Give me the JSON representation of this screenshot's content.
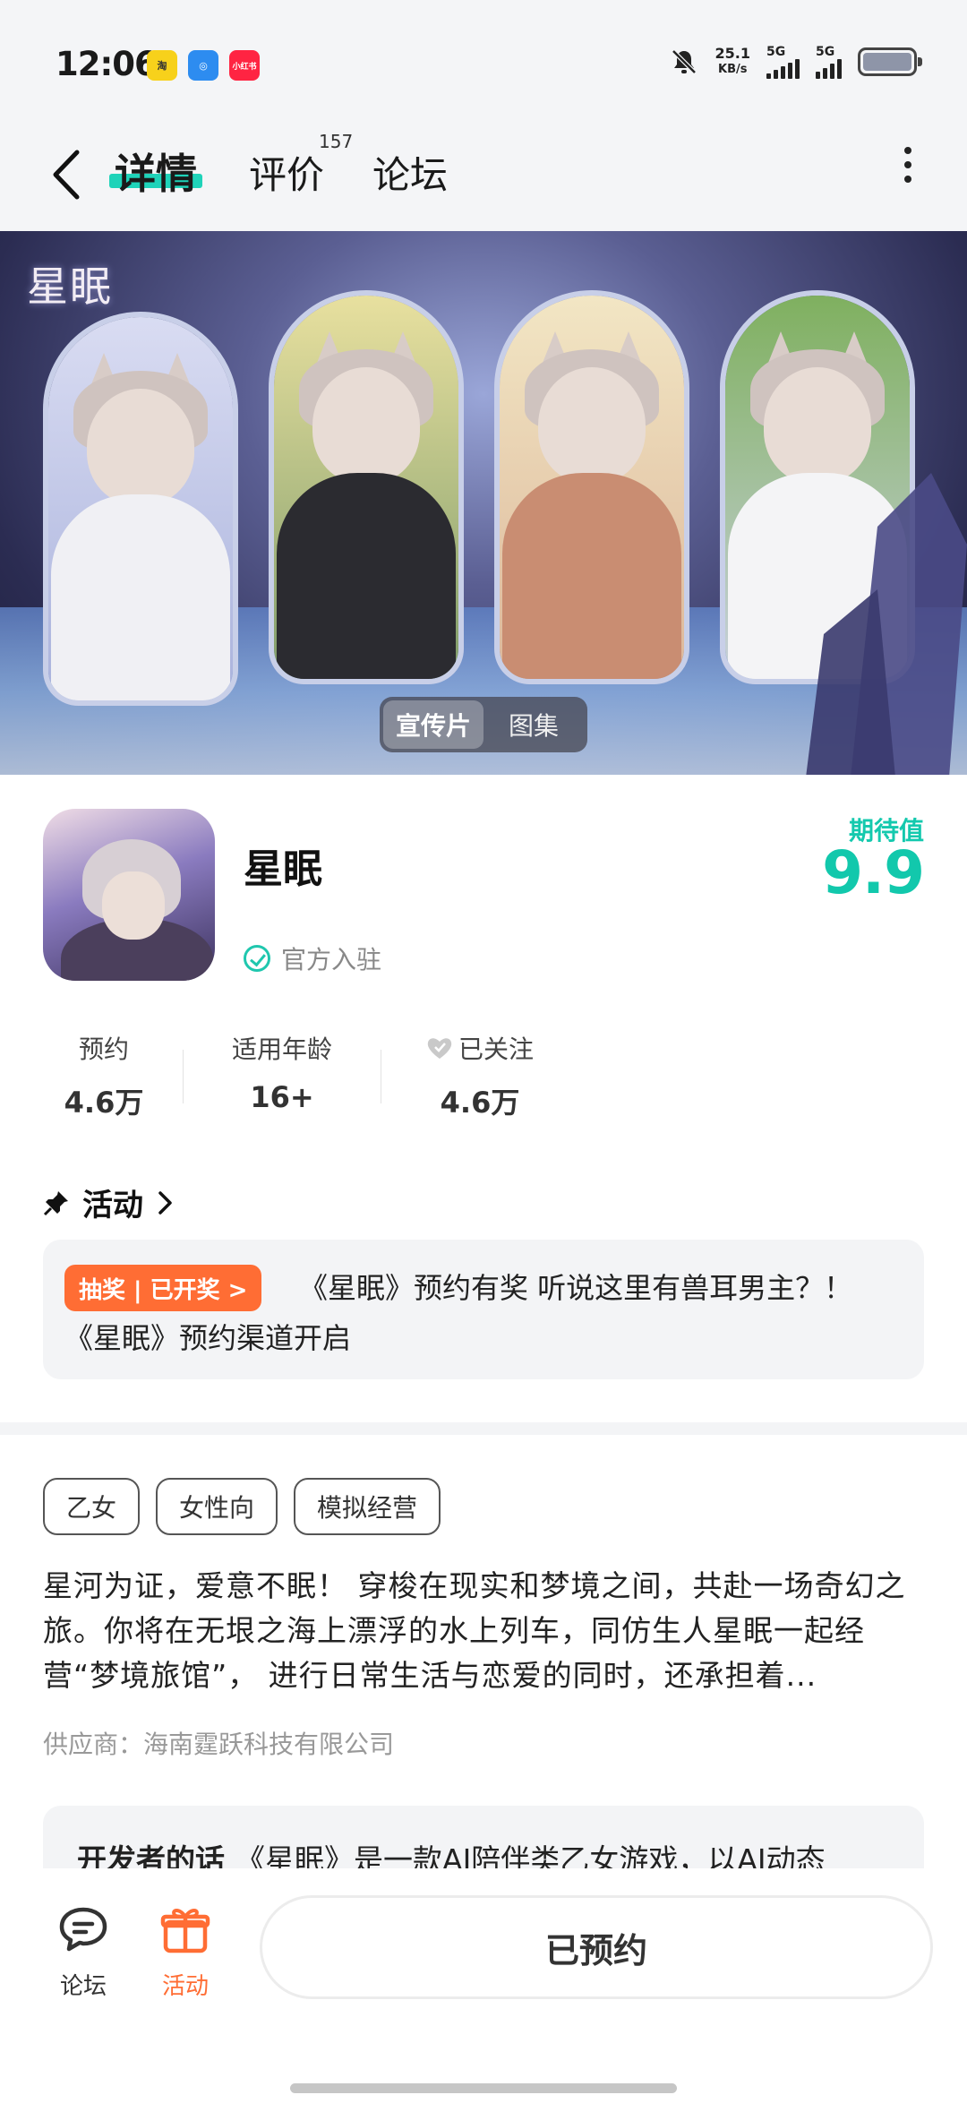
{
  "status_bar": {
    "time": "12:06",
    "apps": [
      {
        "name": "app-1",
        "label": "淘",
        "color": "#f7d11b"
      },
      {
        "name": "app-2",
        "label": "◎",
        "color": "#2d8cf0"
      },
      {
        "name": "app-3",
        "label": "小红书",
        "color": "#ff2442"
      }
    ],
    "speed_value": "25.1",
    "speed_unit": "KB/s",
    "signal_1": "5G",
    "signal_2": "5G"
  },
  "nav": {
    "tabs": [
      {
        "label": "详情"
      },
      {
        "label": "评价"
      },
      {
        "label": "论坛"
      }
    ],
    "review_count": "157"
  },
  "banner": {
    "logo_text": "星眠",
    "switch": {
      "video": "宣传片",
      "gallery": "图集"
    }
  },
  "app": {
    "name": "星眠",
    "official": "官方入驻",
    "expect_label": "期待值",
    "expect_value": "9.9",
    "stats": [
      {
        "label": "预约",
        "value": "4.6万"
      },
      {
        "label": "适用年龄",
        "value": "16+"
      },
      {
        "label": "已关注",
        "value": "4.6万"
      }
    ]
  },
  "activity": {
    "title": "活动",
    "tag": "抽奖 | 已开奖 >",
    "text": "《星眠》预约有奖 听说这里有兽耳男主？！《星眠》预约渠道开启"
  },
  "tags": [
    "乙女",
    "女性向",
    "模拟经营"
  ],
  "description": "星河为证，爱意不眠！ 穿梭在现实和梦境之间，共赴一场奇幻之旅。你将在无垠之海上漂浮的水上列车，同仿生人星眠一起经营“梦境旅馆”， 进行日常生活与恋爱的同时，还承担着...",
  "supplier": "供应商：海南霆跃科技有限公司",
  "developer": {
    "label": "开发者的话",
    "text": "《星眠》是一款AI陪伴类乙女游戏，以AI动态"
  },
  "bottom": {
    "forum": "论坛",
    "activity": "活动",
    "reserve": "已预约"
  },
  "colors": {
    "accent": "#12c8ac",
    "orange": "#ff6d34"
  }
}
